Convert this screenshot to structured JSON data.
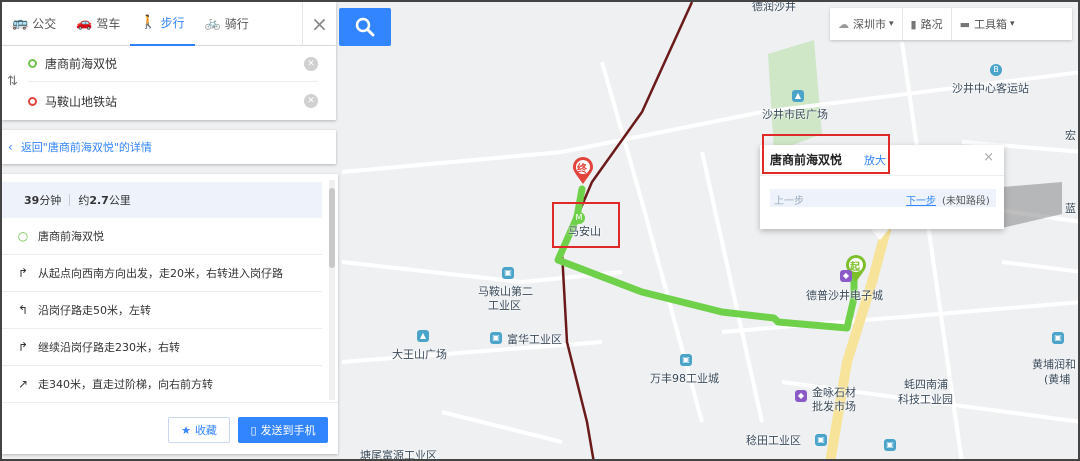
{
  "modes": [
    {
      "label": "公交",
      "icon": "bus-icon",
      "glyph": "🚌",
      "active": false
    },
    {
      "label": "驾车",
      "icon": "car-icon",
      "glyph": "🚗",
      "active": false
    },
    {
      "label": "步行",
      "icon": "walk-icon",
      "glyph": "🚶",
      "active": true
    },
    {
      "label": "骑行",
      "icon": "bike-icon",
      "glyph": "🚲",
      "active": false
    }
  ],
  "route": {
    "start": "唐商前海双悦",
    "end": "马鞍山地铁站"
  },
  "back_link": "返回\"唐商前海双悦\"的详情",
  "summary": {
    "time": "39",
    "time_unit": "分钟",
    "distance_prefix": "约",
    "distance": "2.7",
    "distance_unit": "公里"
  },
  "steps": [
    {
      "icon": "start-dot-icon",
      "glyph": "○",
      "text": "唐商前海双悦"
    },
    {
      "icon": "turn-right-icon",
      "glyph": "↱",
      "text": "从起点向西南方向出发，走20米，右转进入岗仔路"
    },
    {
      "icon": "turn-left-icon",
      "glyph": "↰",
      "text": "沿岗仔路走50米，左转"
    },
    {
      "icon": "turn-right-icon",
      "glyph": "↱",
      "text": "继续沿岗仔路走230米，右转"
    },
    {
      "icon": "slight-right-icon",
      "glyph": "↗",
      "text": "走340米，直走过阶梯，向右前方转"
    }
  ],
  "buttons": {
    "favorite": "收藏",
    "send": "发送到手机"
  },
  "toolbar": {
    "city": "深圳市",
    "traffic": "路况",
    "toolbox": "工具箱"
  },
  "popup": {
    "title": "唐商前海双悦",
    "zoom": "放大",
    "prev": "上一步",
    "next": "下一步",
    "next_note": "(未知路段)"
  },
  "markers": {
    "end": "终",
    "start": "起"
  },
  "map_labels": {
    "station_top": "沙井中心客运站",
    "civic_plaza": "沙井市民广场",
    "maanshan": "马安山",
    "maanshan_park_1": "马鞍山第二",
    "maanshan_park_2": "工业区",
    "fuhua": "富华工业区",
    "dawangshan": "大王山广场",
    "wanfeng": "万丰98工业城",
    "jinwei_1": "金咏石材",
    "jinwei_2": "批发市场",
    "desheng": "德普沙井电子城",
    "nanpu_1": "蚝四南浦",
    "nanpu_2": "科技工业园",
    "huangpu_1": "黄埔润和",
    "huangpu_2": "(黄埔",
    "shaotian": "稔田工业区",
    "tangwei": "塘尾富源工业区",
    "hong": "宏",
    "lan": "蓝",
    "partial_top": "德润沙井"
  },
  "colors": {
    "accent": "#3385ff",
    "route": "#6fd04a",
    "highlight": "#e02a2a",
    "end_marker": "#e2443b",
    "start_marker": "#7cbf2a"
  }
}
